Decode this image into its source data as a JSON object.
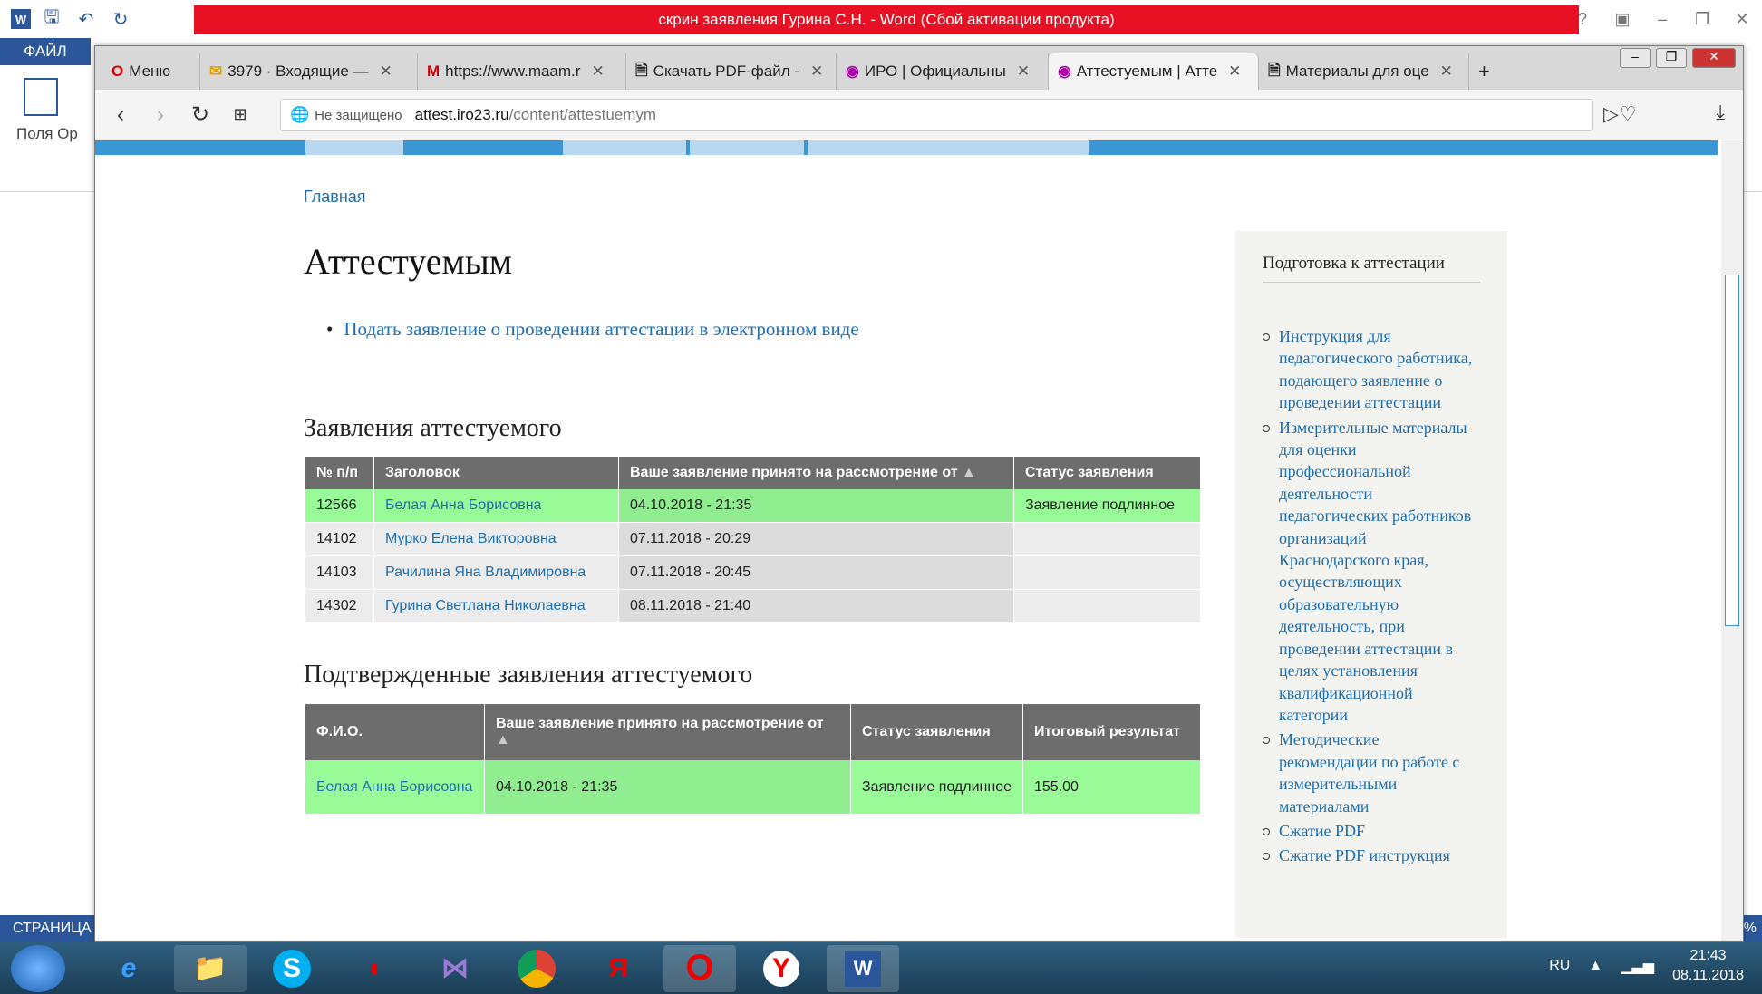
{
  "word": {
    "title": "скрин заявления Гурина С.Н. -  Word (Сбой активации продукта)",
    "file_tab": "ФАЙЛ",
    "fields_label": "Поля",
    "orient_label": "Ор",
    "status_left": "СТРАНИЦА",
    "zoom_pct": "%"
  },
  "browser": {
    "tabs": [
      {
        "label": "Меню",
        "icon": "opera-icon"
      },
      {
        "label": "3979 · Входящие —",
        "icon": "mail-icon"
      },
      {
        "label": "https://www.maam.r",
        "icon": "maam-icon"
      },
      {
        "label": "Скачать PDF-файл -",
        "icon": "doc-icon"
      },
      {
        "label": "ИРО | Официальны",
        "icon": "iro-icon"
      },
      {
        "label": "Аттестуемым | Атте",
        "icon": "iro-icon"
      },
      {
        "label": "Материалы для оце",
        "icon": "doc-icon"
      }
    ],
    "not_secure": "Не защищено",
    "url_host": "attest.iro23.ru",
    "url_path": "/content/attestuemym"
  },
  "page": {
    "breadcrumb": "Главная",
    "title": "Аттестуемым",
    "apply_link": "Подать заявление о проведении аттестации в электронном виде",
    "section1": "Заявления аттестуемого",
    "table1": {
      "headers": [
        "№ п/п",
        "Заголовок",
        "Ваше заявление принято на рассмотрение от",
        "Статус заявления"
      ],
      "rows": [
        {
          "num": "12566",
          "name": "Белая Анна Борисовна",
          "date": "04.10.2018 - 21:35",
          "status": "Заявление подлинное"
        },
        {
          "num": "14102",
          "name": "Мурко Елена Викторовна",
          "date": "07.11.2018 - 20:29",
          "status": ""
        },
        {
          "num": "14103",
          "name": "Рачилина Яна Владимировна",
          "date": "07.11.2018 - 20:45",
          "status": ""
        },
        {
          "num": "14302",
          "name": "Гурина Светлана Николаевна",
          "date": "08.11.2018 - 21:40",
          "status": ""
        }
      ]
    },
    "section2": "Подтвержденные заявления аттестуемого",
    "table2": {
      "headers": [
        "Ф.И.О.",
        "Ваше заявление принято на рассмотрение от",
        "Статус заявления",
        "Итоговый результат"
      ],
      "row": {
        "name": "Белая Анна Борисовна",
        "date": "04.10.2018 - 21:35",
        "status": "Заявление подлинное",
        "result": "155.00"
      }
    },
    "sidebar": {
      "title": "Подготовка к аттестации",
      "items": [
        "Инструкция для педагогического работника, подающего заявление о проведении аттестации",
        "Измерительные материалы для оценки профессиональной деятельности педагогических работников организаций Краснодарского края, осуществляющих образовательную деятельность, при проведении аттестации в целях установления квалификационной категории",
        "Методические рекомендации по работе с измерительными материалами",
        "Сжатие PDF",
        "Сжатие PDF инструкция"
      ]
    }
  },
  "taskbar": {
    "lang": "RU",
    "time": "21:43",
    "date": "08.11.2018",
    "apps": [
      "ie-icon",
      "explorer-icon",
      "skype-icon",
      "app-red-icon",
      "vs-icon",
      "chrome-icon",
      "yandex-icon",
      "opera-icon",
      "yandex-browser-icon",
      "word-icon"
    ]
  }
}
